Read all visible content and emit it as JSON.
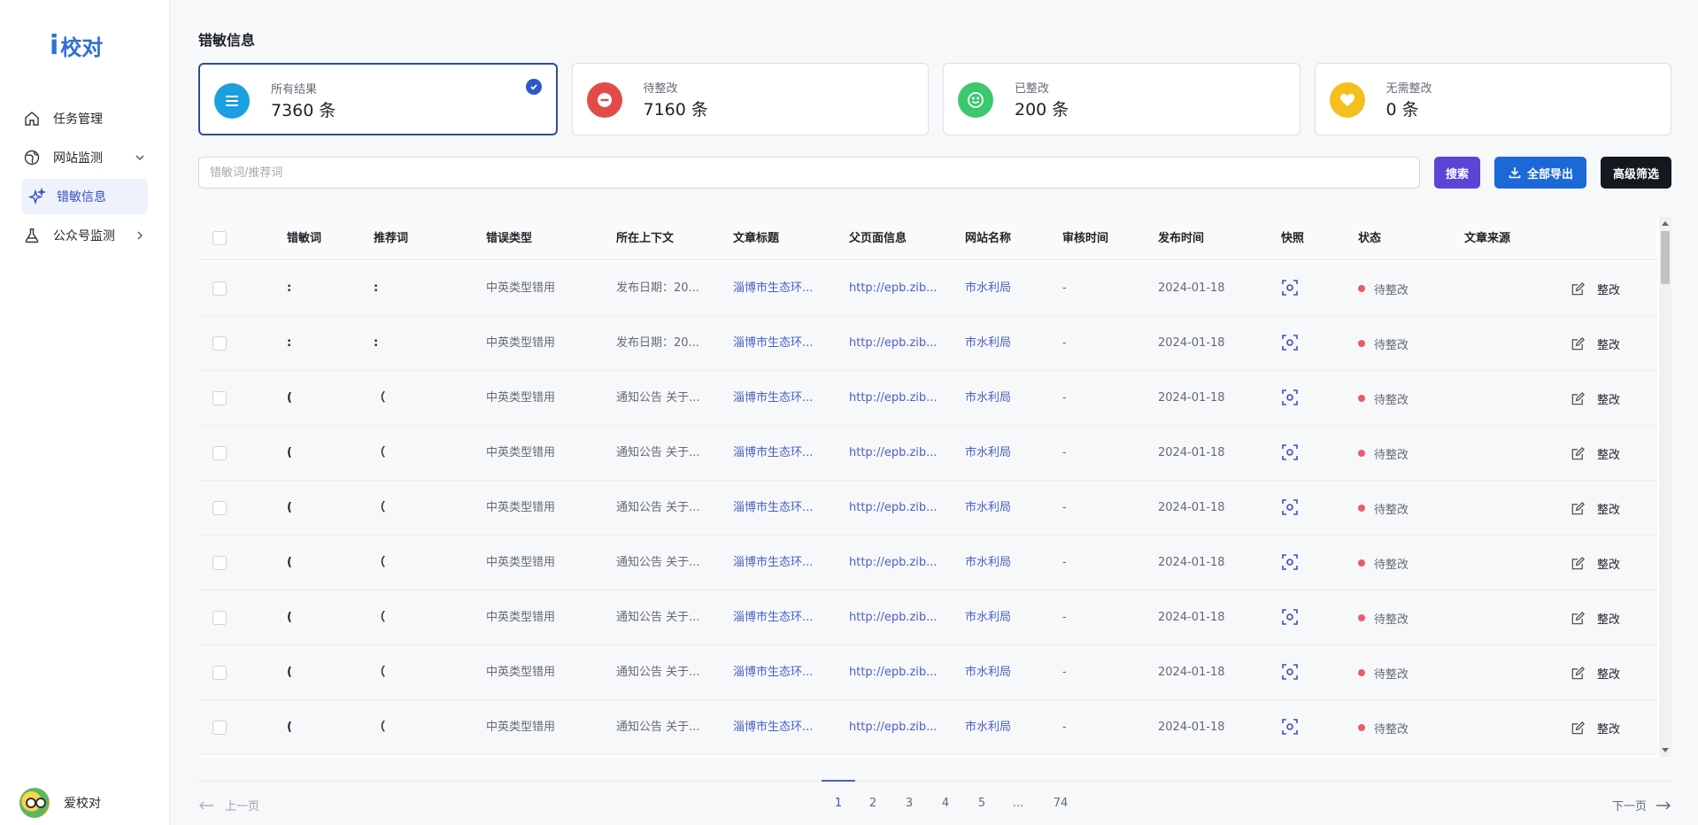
{
  "brand": {
    "mark": "i",
    "name": "校对"
  },
  "sidebar": {
    "items": [
      {
        "label": "任务管理"
      },
      {
        "label": "网站监测"
      },
      {
        "label": "错敏信息"
      },
      {
        "label": "公众号监测"
      }
    ],
    "user": "爱校对"
  },
  "page": {
    "title": "错敏信息"
  },
  "cards": [
    {
      "label": "所有结果",
      "value": "7360 条",
      "color": "#1aa0e0"
    },
    {
      "label": "待整改",
      "value": "7160 条",
      "color": "#e34b4b"
    },
    {
      "label": "已整改",
      "value": "200 条",
      "color": "#3cc86e"
    },
    {
      "label": "无需整改",
      "value": "0 条",
      "color": "#f5c01d"
    }
  ],
  "search": {
    "placeholder": "错敏词/推荐词"
  },
  "buttons": {
    "search": "搜索",
    "export": "全部导出",
    "filter": "高级筛选"
  },
  "table": {
    "columns": [
      "错敏词",
      "推荐词",
      "错误类型",
      "所在上下文",
      "文章标题",
      "父页面信息",
      "网站名称",
      "审核时间",
      "发布时间",
      "快照",
      "状态",
      "文章来源"
    ],
    "rows": [
      {
        "word": ":",
        "suggest": ":",
        "type": "中英类型错用",
        "context": "发布日期：20...",
        "title": "淄博市生态环...",
        "parent": "http://epb.zib...",
        "site": "市水利局",
        "review": "-",
        "date": "2024-01-18",
        "status": "待整改",
        "action": "整改"
      },
      {
        "word": ":",
        "suggest": ":",
        "type": "中英类型错用",
        "context": "发布日期：20...",
        "title": "淄博市生态环...",
        "parent": "http://epb.zib...",
        "site": "市水利局",
        "review": "-",
        "date": "2024-01-18",
        "status": "待整改",
        "action": "整改"
      },
      {
        "word": "(",
        "suggest": "（",
        "type": "中英类型错用",
        "context": "通知公告 关于...",
        "title": "淄博市生态环...",
        "parent": "http://epb.zib...",
        "site": "市水利局",
        "review": "-",
        "date": "2024-01-18",
        "status": "待整改",
        "action": "整改"
      },
      {
        "word": "(",
        "suggest": "（",
        "type": "中英类型错用",
        "context": "通知公告 关于...",
        "title": "淄博市生态环...",
        "parent": "http://epb.zib...",
        "site": "市水利局",
        "review": "-",
        "date": "2024-01-18",
        "status": "待整改",
        "action": "整改"
      },
      {
        "word": "(",
        "suggest": "（",
        "type": "中英类型错用",
        "context": "通知公告 关于...",
        "title": "淄博市生态环...",
        "parent": "http://epb.zib...",
        "site": "市水利局",
        "review": "-",
        "date": "2024-01-18",
        "status": "待整改",
        "action": "整改"
      },
      {
        "word": "(",
        "suggest": "（",
        "type": "中英类型错用",
        "context": "通知公告 关于...",
        "title": "淄博市生态环...",
        "parent": "http://epb.zib...",
        "site": "市水利局",
        "review": "-",
        "date": "2024-01-18",
        "status": "待整改",
        "action": "整改"
      },
      {
        "word": "(",
        "suggest": "（",
        "type": "中英类型错用",
        "context": "通知公告 关于...",
        "title": "淄博市生态环...",
        "parent": "http://epb.zib...",
        "site": "市水利局",
        "review": "-",
        "date": "2024-01-18",
        "status": "待整改",
        "action": "整改"
      },
      {
        "word": "(",
        "suggest": "（",
        "type": "中英类型错用",
        "context": "通知公告 关于...",
        "title": "淄博市生态环...",
        "parent": "http://epb.zib...",
        "site": "市水利局",
        "review": "-",
        "date": "2024-01-18",
        "status": "待整改",
        "action": "整改"
      },
      {
        "word": "(",
        "suggest": "（",
        "type": "中英类型错用",
        "context": "通知公告 关于...",
        "title": "淄博市生态环...",
        "parent": "http://epb.zib...",
        "site": "市水利局",
        "review": "-",
        "date": "2024-01-18",
        "status": "待整改",
        "action": "整改"
      }
    ]
  },
  "pagination": {
    "prev": "上一页",
    "next": "下一页",
    "pages": [
      "1",
      "2",
      "3",
      "4",
      "5",
      "...",
      "74"
    ],
    "current": "1"
  }
}
